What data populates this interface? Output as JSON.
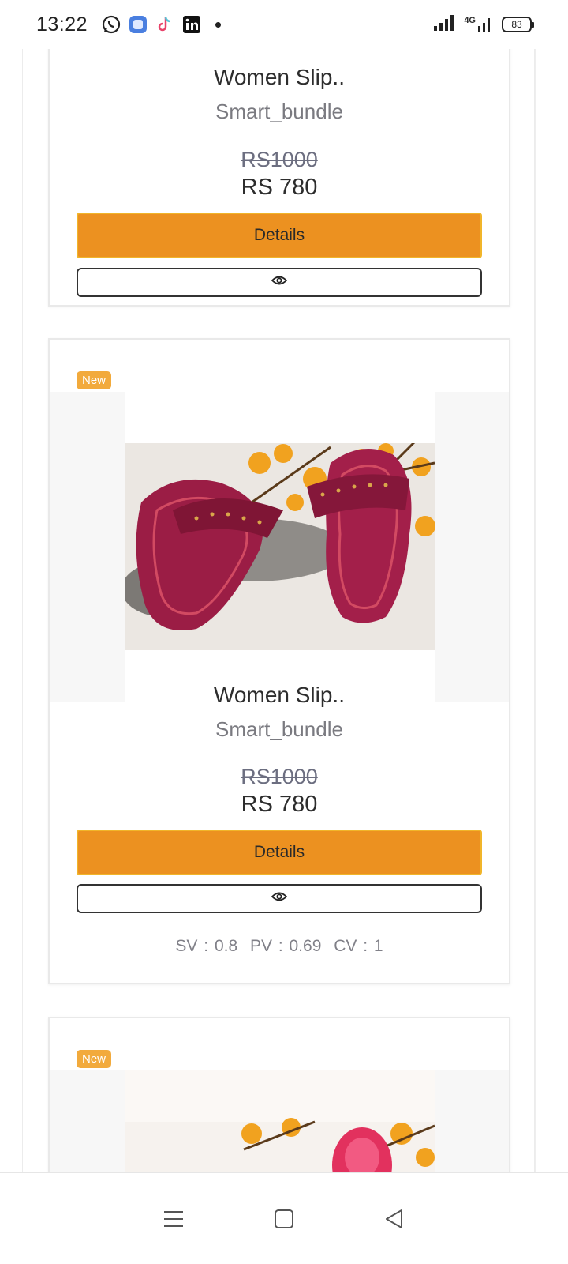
{
  "status_bar": {
    "time": "13:22",
    "app_icons": [
      "whatsapp-icon",
      "messenger-icon",
      "tiktok-icon",
      "linkedin-icon"
    ],
    "network": "4G",
    "battery": "83"
  },
  "products": [
    {
      "title": "Women Slip..",
      "brand": "Smart_bundle",
      "old_price": "RS1000",
      "price": "RS 780",
      "details_label": "Details"
    },
    {
      "badge": "New",
      "title": "Women Slip..",
      "brand": "Smart_bundle",
      "old_price": "RS1000",
      "price": "RS 780",
      "details_label": "Details",
      "metrics": {
        "sv": "SV : 0.8",
        "pv": "PV : 0.69",
        "cv": "CV : 1"
      }
    },
    {
      "badge": "New"
    }
  ],
  "colors": {
    "accent": "#ec9120",
    "badge": "#f2aa3c",
    "slipper": "#9b1d45"
  }
}
